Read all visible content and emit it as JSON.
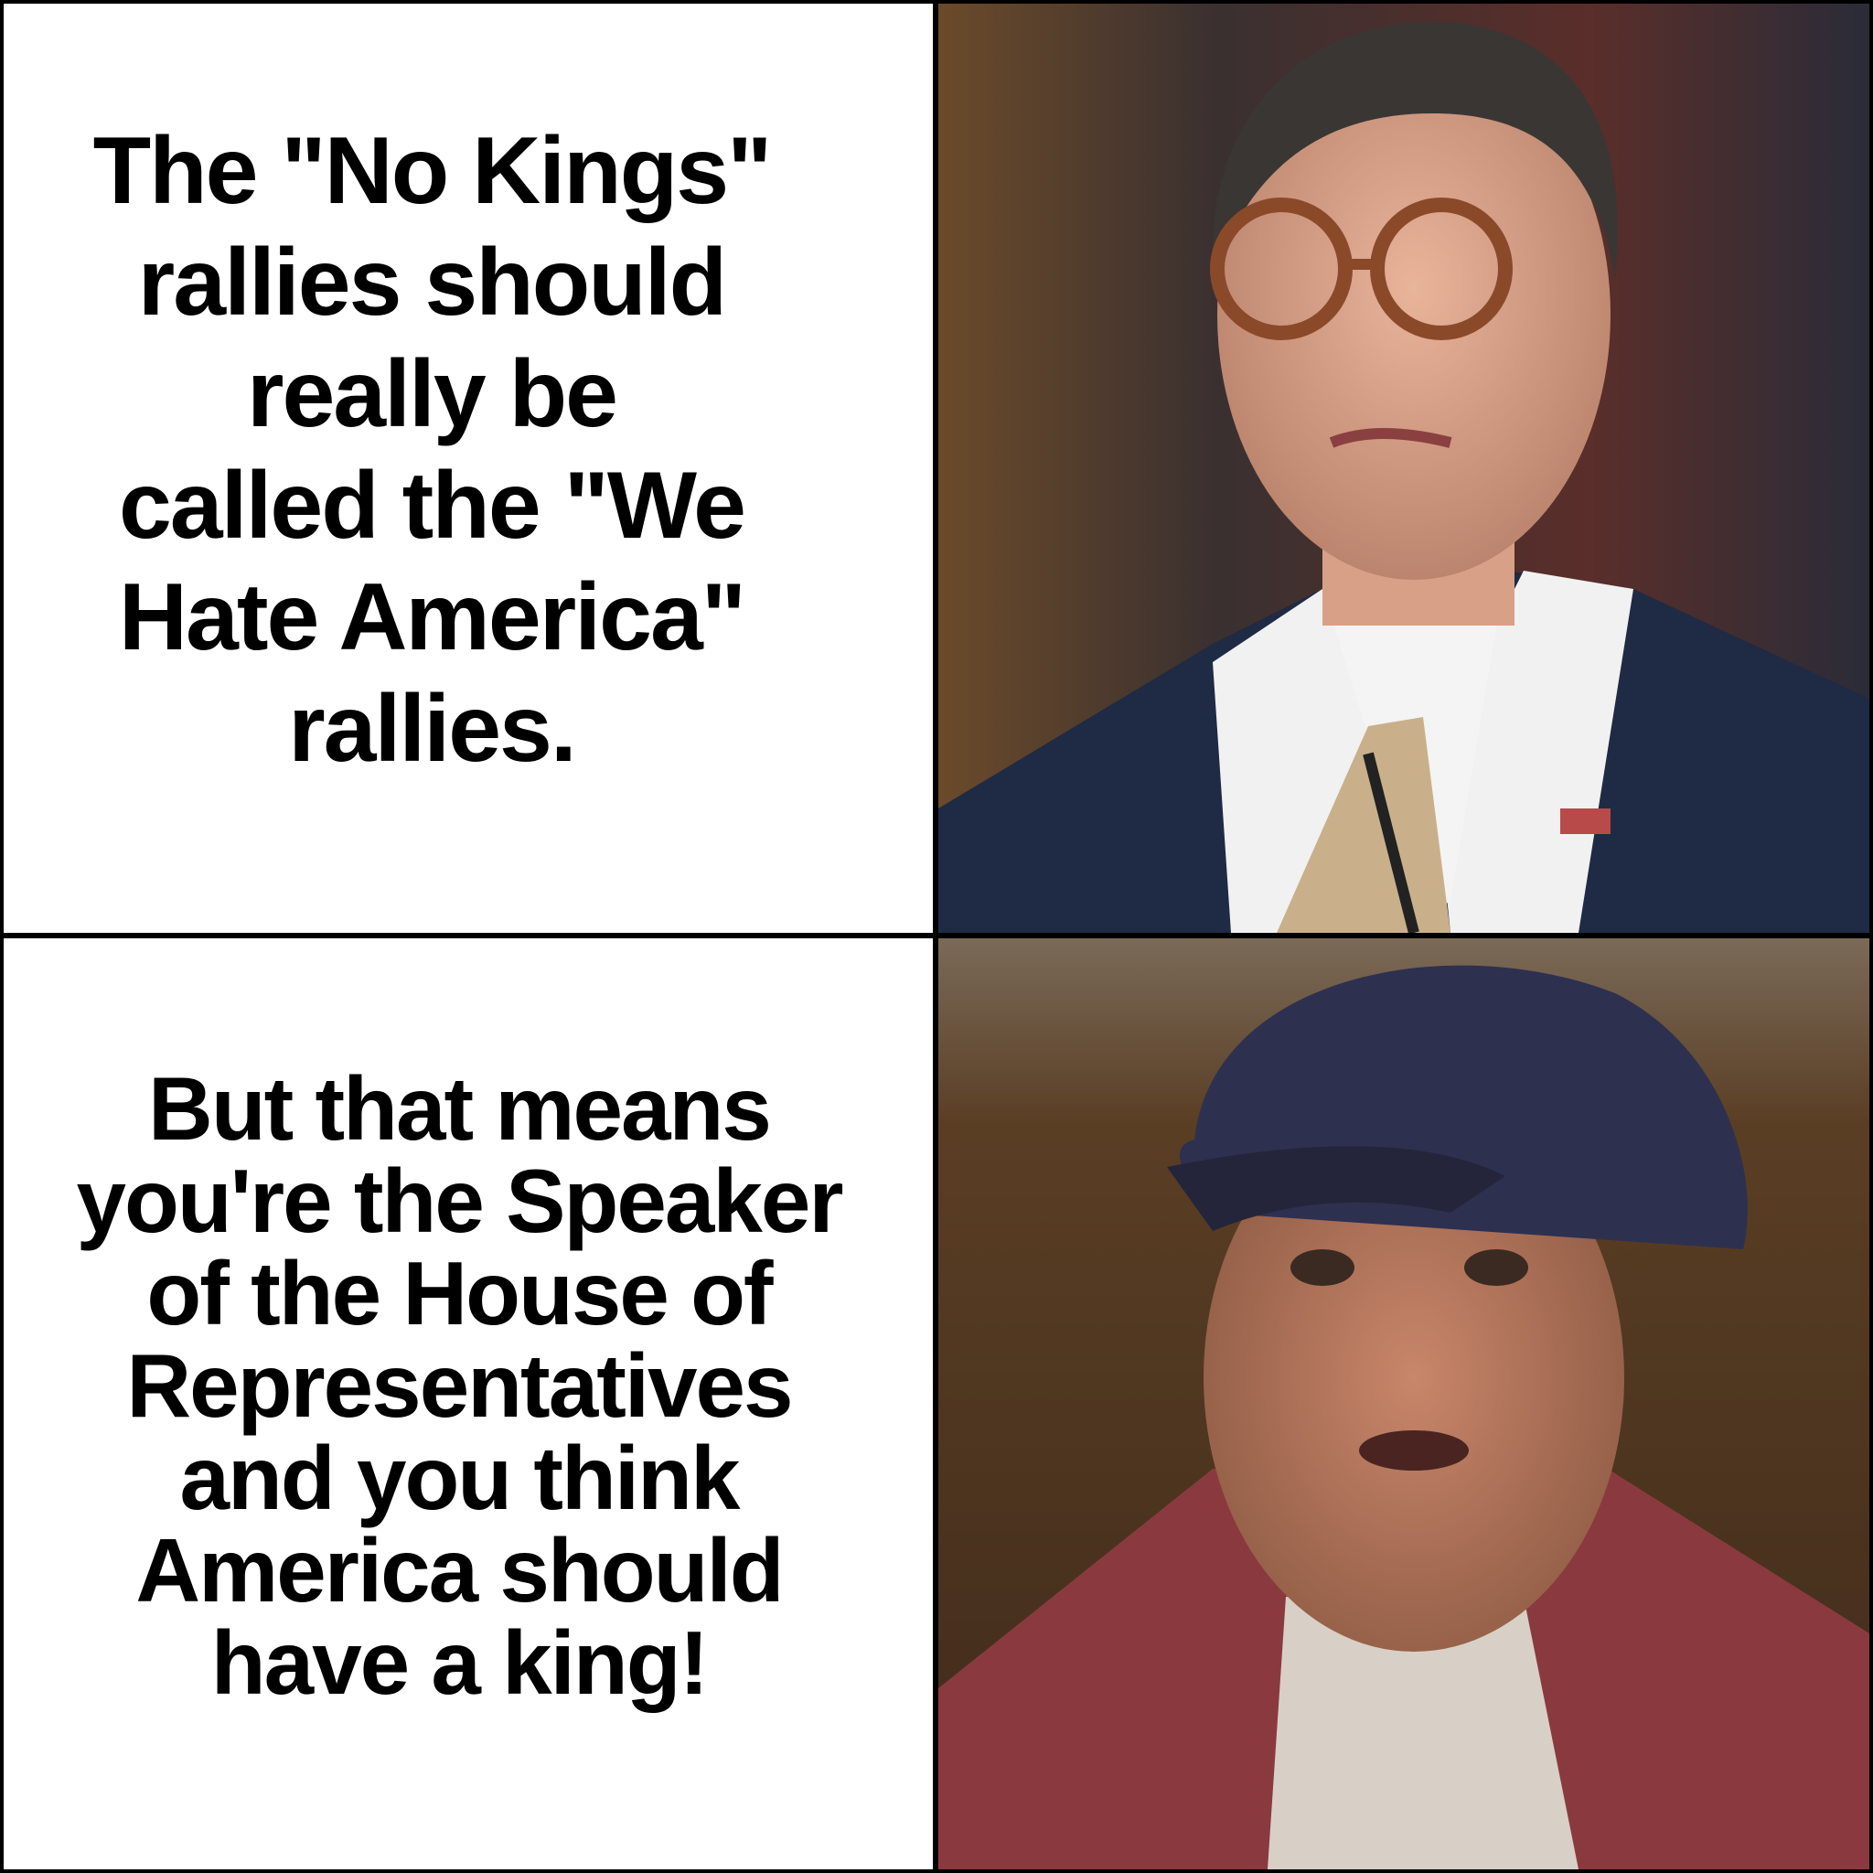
{
  "top_panel": {
    "lines": [
      "The \"No Kings\"",
      "rallies should",
      "really be",
      "called the \"We",
      "Hate America\"",
      "rallies."
    ]
  },
  "bottom_panel": {
    "lines": [
      "But that means",
      "you're the Speaker",
      "of the House of",
      "Representatives",
      "and you think",
      "America should",
      "have a king!"
    ]
  },
  "photos": {
    "top": "man-in-suit-and-glasses-photo",
    "bottom": "man-in-cap-surprised-photo"
  },
  "colors": {
    "border": "#000000",
    "panel": "#ffffff",
    "text": "#000000"
  }
}
